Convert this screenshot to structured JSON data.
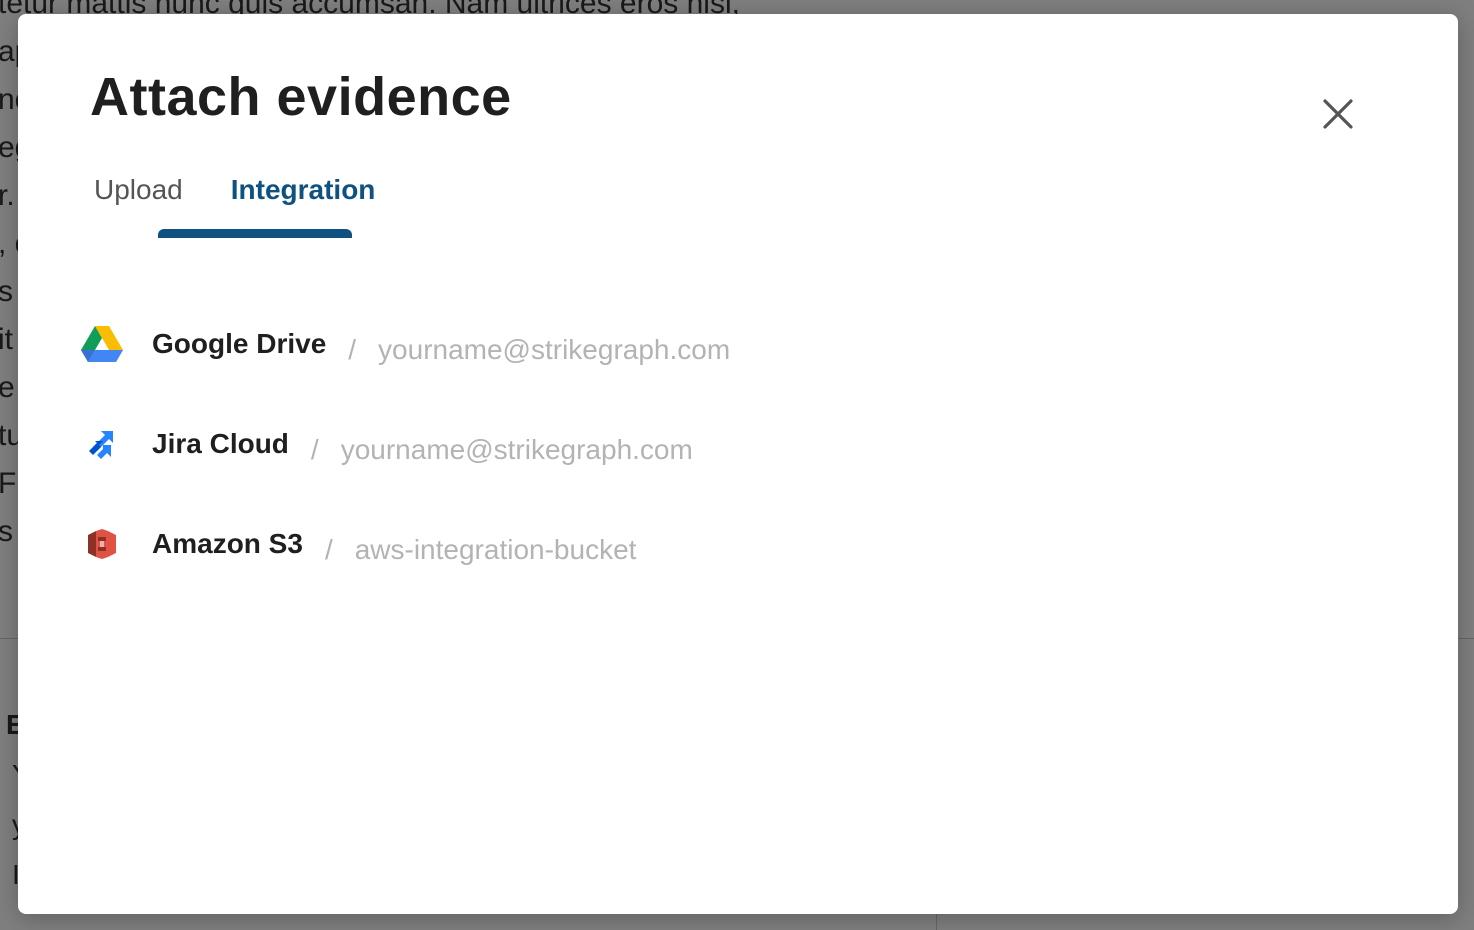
{
  "background": {
    "text_lines": [
      "tetur mattis nunc quis accumsan. Nam ultrices eros nisi,",
      "ap",
      "no",
      "eg",
      "r.",
      ", c",
      "s s",
      "it",
      "e",
      "tu",
      " F",
      "s a"
    ],
    "lower_lines": [
      "E",
      " Y",
      " y",
      " I"
    ]
  },
  "modal": {
    "title": "Attach evidence",
    "close_label": "×",
    "tabs": [
      {
        "label": "Upload",
        "active": false
      },
      {
        "label": "Integration",
        "active": true
      }
    ],
    "integrations": [
      {
        "name": "Google Drive",
        "separator": "/",
        "account": "yourname@strikegraph.com",
        "icon": "google-drive-icon"
      },
      {
        "name": "Jira Cloud",
        "separator": "/",
        "account": "yourname@strikegraph.com",
        "icon": "jira-icon"
      },
      {
        "name": "Amazon S3",
        "separator": "/",
        "account": "aws-integration-bucket",
        "icon": "amazon-s3-icon"
      }
    ]
  },
  "colors": {
    "accent": "#0f5282",
    "title": "#1f1f1f",
    "muted": "#b3b3b3",
    "overlay": "rgba(0,0,0,0.5)"
  }
}
